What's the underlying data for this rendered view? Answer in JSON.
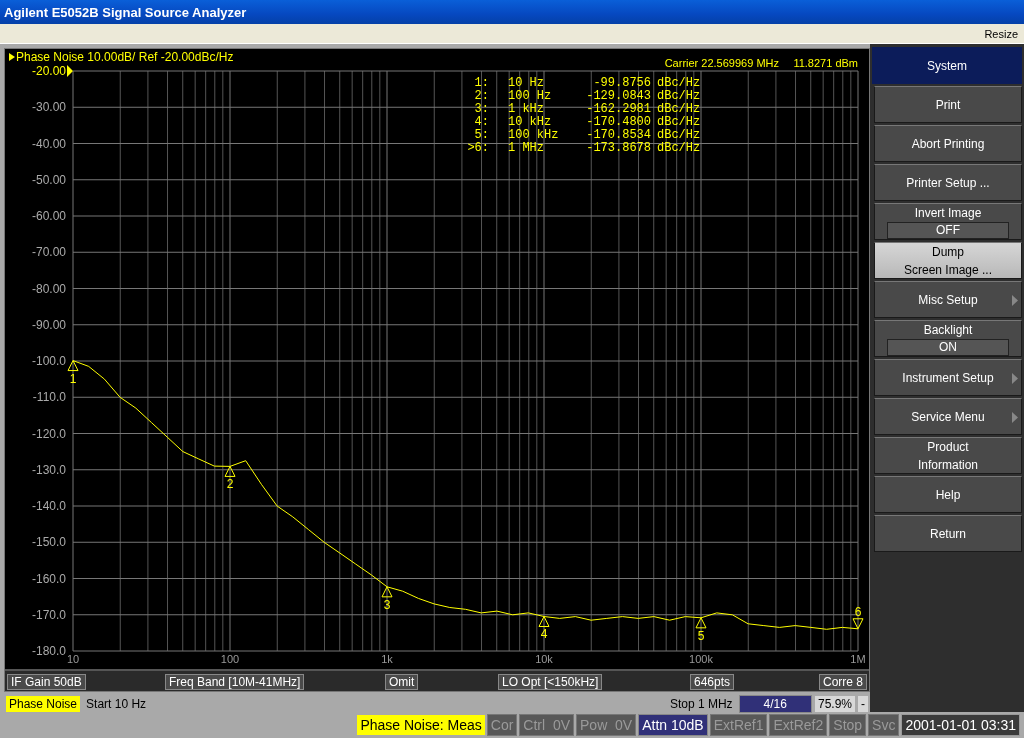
{
  "window": {
    "title": "Agilent E5052B Signal Source Analyzer"
  },
  "menu_bar": {
    "resize": "Resize"
  },
  "trace": {
    "title": "Phase Noise 10.00dB/ Ref -20.00dBc/Hz",
    "carrier": "Carrier 22.569969 MHz",
    "carrier_power": "11.8271 dBm",
    "marker_table": [
      {
        "id": "1:",
        "freq": "10 Hz",
        "value": "-99.8756",
        "unit": "dBc/Hz",
        "active": false
      },
      {
        "id": "2:",
        "freq": "100 Hz",
        "value": "-129.0843",
        "unit": "dBc/Hz",
        "active": false
      },
      {
        "id": "3:",
        "freq": "1 kHz",
        "value": "-162.2981",
        "unit": "dBc/Hz",
        "active": false
      },
      {
        "id": "4:",
        "freq": "10 kHz",
        "value": "-170.4800",
        "unit": "dBc/Hz",
        "active": false
      },
      {
        "id": "5:",
        "freq": "100 kHz",
        "value": "-170.8534",
        "unit": "dBc/Hz",
        "active": false
      },
      {
        "id": ">6:",
        "freq": "1 MHz",
        "value": "-173.8678",
        "unit": "dBc/Hz",
        "active": true
      }
    ],
    "chart_data": {
      "type": "line",
      "categories": [
        "10",
        null,
        null,
        null,
        null,
        null,
        null,
        null,
        null,
        null,
        "100",
        null,
        null,
        null,
        null,
        null,
        null,
        null,
        null,
        null,
        "1k",
        null,
        null,
        null,
        null,
        null,
        null,
        null,
        null,
        null,
        "10k",
        null,
        null,
        null,
        null,
        null,
        null,
        null,
        null,
        null,
        "100k",
        null,
        null,
        null,
        null,
        null,
        null,
        null,
        null,
        null,
        "1M"
      ],
      "series": [
        {
          "color": "#ffff00",
          "values": [
            -99.88,
            -101.5,
            -105,
            -110,
            -113,
            -117,
            -121,
            -125,
            -127,
            -129,
            -129.08,
            -127.5,
            -134,
            -140,
            -143,
            -146.5,
            -150,
            -153,
            -156,
            -159,
            -162.3,
            -163.5,
            -165.5,
            -167,
            -168,
            -168.5,
            -169.5,
            -169,
            -170,
            -169.5,
            -170.48,
            -171,
            -170.5,
            -171.5,
            -171,
            -170.5,
            -171,
            -170.5,
            -171.5,
            -170.5,
            -170.85,
            -169.5,
            -170,
            -172.5,
            -173,
            -173.5,
            -173,
            -173.5,
            -174,
            -173.5,
            -173.87
          ]
        }
      ],
      "ylim": [
        -180,
        -20
      ],
      "grid": true,
      "yticks": [
        {
          "value": -20,
          "label": "-20.00"
        },
        {
          "value": -30,
          "label": "-30.00"
        },
        {
          "value": -40,
          "label": "-40.00"
        },
        {
          "value": -50,
          "label": "-50.00"
        },
        {
          "value": -60,
          "label": "-60.00"
        },
        {
          "value": -70,
          "label": "-70.00"
        },
        {
          "value": -80,
          "label": "-80.00"
        },
        {
          "value": -90,
          "label": "-90.00"
        },
        {
          "value": -100,
          "label": "-100.0"
        },
        {
          "value": -110,
          "label": "-110.0"
        },
        {
          "value": -120,
          "label": "-120.0"
        },
        {
          "value": -130,
          "label": "-130.0"
        },
        {
          "value": -140,
          "label": "-140.0"
        },
        {
          "value": -150,
          "label": "-150.0"
        },
        {
          "value": -160,
          "label": "-160.0"
        },
        {
          "value": -170,
          "label": "-170.0"
        },
        {
          "value": -180,
          "label": "-180.0"
        }
      ],
      "annotations": [
        {
          "x": "10",
          "y": -99.88,
          "text": "1"
        },
        {
          "x": "100",
          "y": -129.08,
          "text": "2"
        },
        {
          "x": "1k",
          "y": -162.3,
          "text": "3"
        },
        {
          "x": "10k",
          "y": -170.48,
          "text": "4"
        },
        {
          "x": "100k",
          "y": -170.85,
          "text": "5"
        },
        {
          "x": "1M",
          "y": -173.87,
          "text": "6"
        }
      ]
    },
    "info_boxes": [
      "IF Gain 50dB",
      "Freq Band [10M-41MHz]",
      "Omit",
      "LO Opt [<150kHz]",
      "646pts",
      "Corre 8"
    ],
    "status_left": [
      {
        "text": "Phase Noise",
        "kind": "highlight"
      },
      {
        "text": "Start 10 Hz",
        "kind": "plain"
      }
    ],
    "status_right": [
      {
        "text": "Stop 1 MHz",
        "kind": "plain"
      },
      {
        "text": "4/16",
        "kind": "on"
      },
      {
        "text": "75.9%",
        "kind": "light"
      },
      {
        "text": "-",
        "kind": "light"
      }
    ]
  },
  "softkeys": {
    "title": "System",
    "items": [
      {
        "label": "Print",
        "submenu": false,
        "selected": false
      },
      {
        "label": "Abort Printing",
        "submenu": false,
        "selected": false
      },
      {
        "label": "Printer Setup ...",
        "submenu": false,
        "selected": false
      },
      {
        "label": "Invert Image",
        "value": "OFF",
        "submenu": false,
        "selected": false
      },
      {
        "label": "Dump\nScreen Image ...",
        "submenu": false,
        "selected": true
      },
      {
        "label": "Misc Setup",
        "submenu": true,
        "selected": false
      },
      {
        "label": "Backlight",
        "value": "ON",
        "submenu": false,
        "selected": false
      },
      {
        "label": "Instrument Setup",
        "submenu": true,
        "selected": false
      },
      {
        "label": "Service Menu",
        "submenu": true,
        "selected": false
      },
      {
        "label": "Product\nInformation",
        "submenu": false,
        "selected": false
      },
      {
        "label": "Help",
        "submenu": false,
        "selected": false
      },
      {
        "label": "Return",
        "submenu": false,
        "selected": false
      }
    ]
  },
  "status_bar": [
    {
      "text": "Phase Noise: Meas",
      "kind": "highlight"
    },
    {
      "text": "Cor",
      "kind": "off"
    },
    {
      "text": "Ctrl  0V",
      "kind": "off"
    },
    {
      "text": "Pow  0V",
      "kind": "off"
    },
    {
      "text": "Attn 10dB",
      "kind": "on"
    },
    {
      "text": "ExtRef1",
      "kind": "off"
    },
    {
      "text": "ExtRef2",
      "kind": "off"
    },
    {
      "text": "Stop",
      "kind": "off"
    },
    {
      "text": "Svc",
      "kind": "off"
    },
    {
      "text": "2001-01-01 03:31",
      "kind": "plain"
    }
  ]
}
